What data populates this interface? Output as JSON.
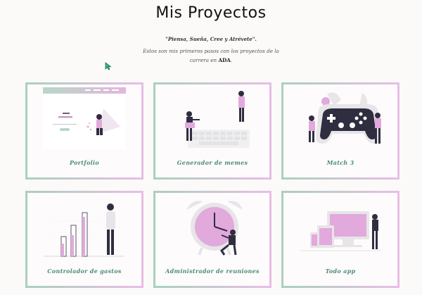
{
  "page": {
    "title": "Mis Proyectos",
    "quote": "\"Piensa, Sueña, Cree y Atrévete\".",
    "description_before": "Estos son mis primeros pasos con los proyectos de la carrera en ",
    "description_bold": "ADA",
    "description_after": "."
  },
  "colors": {
    "accent_green": "#4c8d77",
    "accent_pink": "#e2a9dc",
    "border_green": "#a9d1bb",
    "border_pink": "#e9bde6"
  },
  "projects": [
    {
      "label": "Portfolio",
      "icon": "portfolio-illustration"
    },
    {
      "label": "Generador de memes",
      "icon": "meme-generator-illustration"
    },
    {
      "label": "Match 3",
      "icon": "gamepad-illustration"
    },
    {
      "label": "Controlador de gastos",
      "icon": "bar-chart-illustration"
    },
    {
      "label": "Administrador de reuniones",
      "icon": "alarm-clock-illustration"
    },
    {
      "label": "Todo app",
      "icon": "devices-illustration"
    }
  ],
  "portfolio_preview": {
    "text": "Hola Soy"
  }
}
